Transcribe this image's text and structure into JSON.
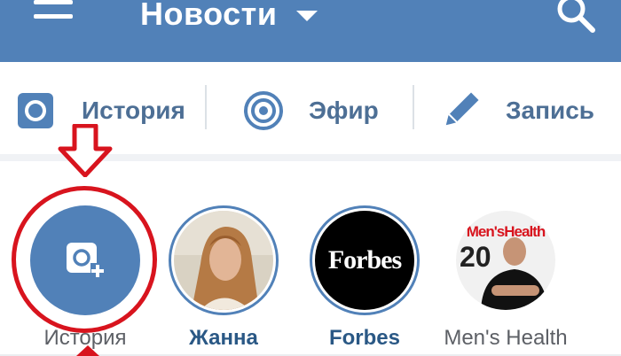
{
  "header": {
    "title": "Новости",
    "bg_color": "#5181b8"
  },
  "actions": [
    {
      "label": "История",
      "icon": "camera-square-icon"
    },
    {
      "label": "Эфир",
      "icon": "live-broadcast-icon"
    },
    {
      "label": "Запись",
      "icon": "pencil-icon"
    }
  ],
  "stories": [
    {
      "label": "История",
      "icon": "add-photo-icon"
    },
    {
      "label": "Жанна",
      "icon": "avatar"
    },
    {
      "label": "Forbes",
      "logo_text": "Forbes"
    },
    {
      "label": "Men's Health",
      "cover_text": "Men'sHealth",
      "cover_number": "20"
    }
  ],
  "colors": {
    "accent": "#5181b8",
    "link": "#2a5885",
    "highlight": "#d8141e"
  }
}
